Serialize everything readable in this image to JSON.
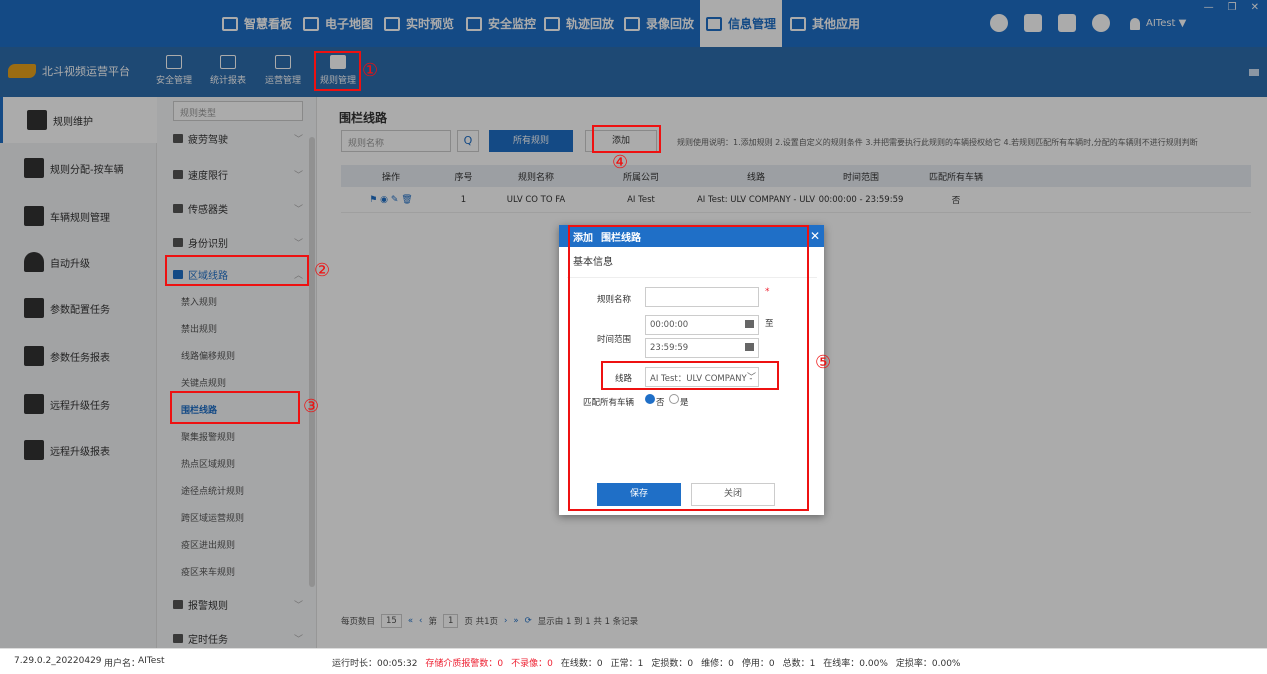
{
  "top_nav": {
    "items": [
      {
        "label": "智慧看板",
        "icon": "chart-board-icon"
      },
      {
        "label": "电子地图",
        "icon": "map-pin-icon"
      },
      {
        "label": "实时预览",
        "icon": "play-icon"
      },
      {
        "label": "安全监控",
        "icon": "shield-icon"
      },
      {
        "label": "轨迹回放",
        "icon": "location-icon"
      },
      {
        "label": "录像回放",
        "icon": "video-camera-icon"
      },
      {
        "label": "信息管理",
        "icon": "card-icon"
      },
      {
        "label": "其他应用",
        "icon": "apps-icon"
      }
    ],
    "active_index": 6,
    "user": "AITest ▼"
  },
  "sub_nav": {
    "brand": "北斗视频运营平台",
    "items": [
      "安全管理",
      "统计报表",
      "运营管理",
      "规则管理"
    ]
  },
  "left_nav": {
    "items": [
      "规则维护",
      "规则分配-按车辆",
      "车辆规则管理",
      "自动升级",
      "参数配置任务",
      "参数任务报表",
      "远程升级任务",
      "远程升级报表"
    ]
  },
  "mid_nav": {
    "rule_type_placeholder": "规则类型",
    "groups": [
      {
        "label": "疲劳驾驶",
        "chevron": "﹀"
      },
      {
        "label": "速度限行",
        "chevron": "﹀"
      },
      {
        "label": "传感器类",
        "chevron": "﹀"
      },
      {
        "label": "身份识别",
        "chevron": "﹀"
      },
      {
        "label": "区域线路",
        "chevron": "︿"
      }
    ],
    "sub_items": [
      "禁入规则",
      "禁出规则",
      "线路偏移规则",
      "关键点规则",
      "围栏线路",
      "聚集报警规则",
      "热点区域规则",
      "途径点统计规则",
      "跨区域运营规则",
      "疫区进出规则",
      "疫区来车规则"
    ],
    "bottom_groups": [
      {
        "label": "报警规则",
        "chevron": "﹀"
      },
      {
        "label": "定时任务",
        "chevron": "﹀"
      }
    ]
  },
  "content": {
    "title": "围栏线路",
    "search_placeholder": "规则名称",
    "search_icon": "Q",
    "all_rules_button": "所有规则",
    "add_button": "添加",
    "usage_text": "规则使用说明：1.添加规则 2.设置自定义的规则条件 3.并把需要执行此规则的车辆授权给它 4.若规则匹配所有车辆时,分配的车辆则不进行规则判断",
    "table": {
      "headers": [
        "操作",
        "序号",
        "规则名称",
        "所属公司",
        "线路",
        "时间范围",
        "匹配所有车辆"
      ],
      "rows": [
        {
          "ops": "⚑ ◉ ✎ 🗑",
          "index": "1",
          "name": "ULV CO TO FA",
          "company": "AI Test",
          "route": "AI Test: ULV COMPANY - ULV",
          "time": "00:00:00 - 23:59:59",
          "match_all": "否"
        }
      ]
    },
    "pager": {
      "per_page_label": "每页数目",
      "per_page": "15",
      "page_prefix": "第",
      "page": "1",
      "page_suffix": "页 共1页",
      "summary": "显示由 1 到 1 共 1 条记录"
    }
  },
  "modal": {
    "title_prefix": "添加",
    "title": "围栏线路",
    "close": "✕",
    "section": "基本信息",
    "rule_name_label": "规则名称",
    "required_mark": "*",
    "time_label": "时间范围",
    "time_start": "00:00:00",
    "time_end": "23:59:59",
    "time_to": "至",
    "route_label": "线路",
    "route_value": "AI Test：ULV COMPANY -",
    "match_label": "匹配所有车辆",
    "opt_no": "否",
    "opt_yes": "是",
    "save": "保存",
    "close_button": "关闭"
  },
  "annotations": [
    "①",
    "②",
    "③",
    "④",
    "⑤"
  ],
  "status_bar": {
    "version": "7.29.0.2_20220429",
    "user_label": "用户名：",
    "user": "AITest",
    "runtime": "运行时长：00:05:32",
    "storage_alarm": "存储介质报警数：0",
    "no_record": "不录像：0",
    "online": "在线数：0",
    "normal": "正常：1",
    "damaged": "定损数：0",
    "repair": "维修：0",
    "stopped": "停用：0",
    "total": "总数：1",
    "online_rate": "在线率：0.00%",
    "damage_rate": "定损率：0.00%"
  },
  "colors": {
    "primary": "#1f6fc7",
    "annotation": "#e11111",
    "warning": "#e22233"
  }
}
